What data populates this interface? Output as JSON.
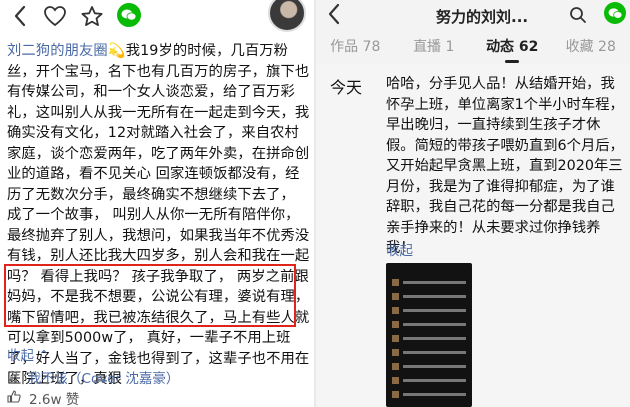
{
  "left": {
    "author": "刘二狗的朋友圈",
    "post_text_after_author": "我19岁的时候，几百万粉丝，开个宝马，名下也有几百万的房子，旗下也有传媒公司，和一个女人谈恋爱，给了百万彩礼，这叫别人从我一无所有在一起走到今天，我确实没有文化，12对就踏入社会了，来自农村家庭，谈个恋爱两年，吃了两年外卖，在拼命创业的道路，看不见关心 回家连顿饭都没有，经历了无数次分手，最终确实不想继续下去了， 成了一个故事， 叫别人从你一无所有陪伴你，最终抛弃了别人，我想问，如果我当年不优秀没有钱，别人还比我大四岁多，别人会和我在一起吗？ 看得上我吗？ 孩子我争取了， 两岁之前跟妈妈，不是我不想要，公说公有理，婆说有理，嘴下留情吧，我已被冻结很久了，马上有些人就可以拿到5000w了， 真好，一辈子不用上班了，好人当了，金钱也得到了，这辈子也不用在医院上班了，真狠",
    "collapse_label": "收起",
    "music_label": "我不该（Cover 沈嘉豪）",
    "likes_label": "2.6w 赞"
  },
  "right": {
    "title": "努力的刘刘...",
    "tabs": [
      {
        "label": "作品 78"
      },
      {
        "label": "直播 1"
      },
      {
        "label": "动态 62"
      },
      {
        "label": "收藏 28"
      }
    ],
    "active_tab": 2,
    "date_label": "今天",
    "post_text": "哈哈，分手见人品！从结婚开始，我怀孕上班，单位离家1个半小时车程，早出晚归，一直持续到生孩子才休假。简短的带孩子喂奶直到6个月后，又开始起早贪黑上班，直到2020年三月份，我是为了谁得抑郁症，为了谁辞职，我自己花的每一分都是我自己亲手挣来的！从未要求过你挣钱养我！",
    "collapse_label": "收起"
  },
  "colors": {
    "link_blue": "#4a6aa6",
    "highlight_red": "#e0241b",
    "wechat_green": "#09bb07"
  }
}
